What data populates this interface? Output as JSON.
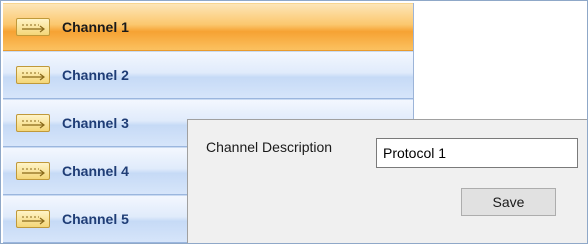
{
  "channel_list": {
    "items": [
      {
        "label": "Channel 1",
        "selected": true
      },
      {
        "label": "Channel 2",
        "selected": false
      },
      {
        "label": "Channel 3",
        "selected": false
      },
      {
        "label": "Channel 4",
        "selected": false
      },
      {
        "label": "Channel 5",
        "selected": false
      }
    ],
    "item_icon": "channel-connector-icon"
  },
  "description_panel": {
    "label": "Channel Description",
    "value": "Protocol 1",
    "save_label": "Save"
  },
  "colors": {
    "selected_accent": "#f6a233",
    "item_text": "#1f3d76"
  }
}
